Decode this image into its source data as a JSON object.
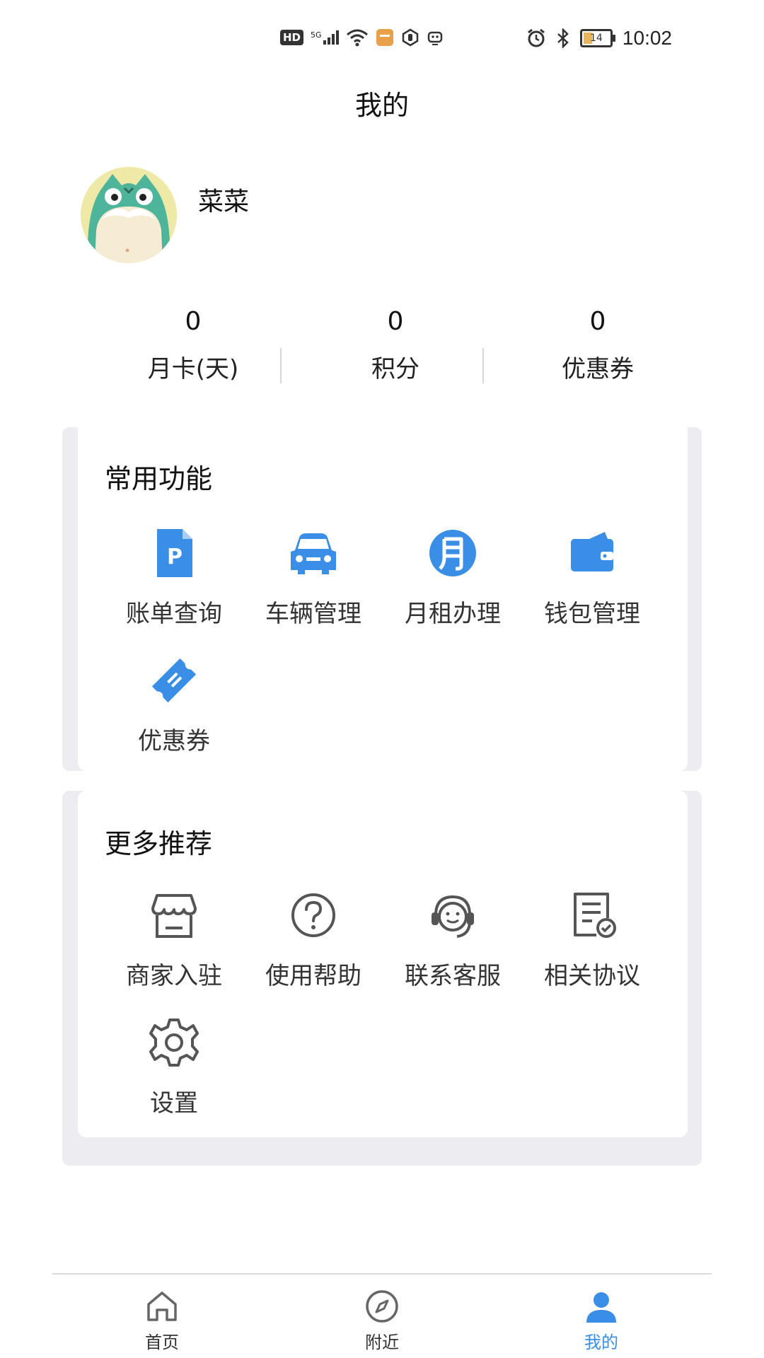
{
  "status_bar": {
    "network_label": "HD",
    "signal_label": "5G",
    "battery_level": "14",
    "time": "10:02"
  },
  "page_title": "我的",
  "profile": {
    "username": "菜菜"
  },
  "stats": [
    {
      "value": "0",
      "label": "月卡(天)"
    },
    {
      "value": "0",
      "label": "积分"
    },
    {
      "value": "0",
      "label": "优惠券"
    }
  ],
  "common_functions": {
    "title": "常用功能",
    "items": [
      {
        "label": "账单查询",
        "icon": "parking-bill-icon"
      },
      {
        "label": "车辆管理",
        "icon": "car-icon"
      },
      {
        "label": "月租办理",
        "icon": "monthly-rent-icon"
      },
      {
        "label": "钱包管理",
        "icon": "wallet-icon"
      },
      {
        "label": "优惠券",
        "icon": "coupon-icon"
      }
    ]
  },
  "more_recommend": {
    "title": "更多推荐",
    "items": [
      {
        "label": "商家入驻",
        "icon": "store-icon"
      },
      {
        "label": "使用帮助",
        "icon": "help-icon"
      },
      {
        "label": "联系客服",
        "icon": "customer-service-icon"
      },
      {
        "label": "相关协议",
        "icon": "agreement-icon"
      },
      {
        "label": "设置",
        "icon": "settings-icon"
      }
    ]
  },
  "tab_bar": [
    {
      "label": "首页",
      "icon": "home-icon",
      "active": false
    },
    {
      "label": "附近",
      "icon": "compass-icon",
      "active": false
    },
    {
      "label": "我的",
      "icon": "user-icon",
      "active": true
    }
  ],
  "colors": {
    "accent": "#3a8ee6",
    "icon_gray": "#555555",
    "card_shadow": "#ececf1"
  }
}
